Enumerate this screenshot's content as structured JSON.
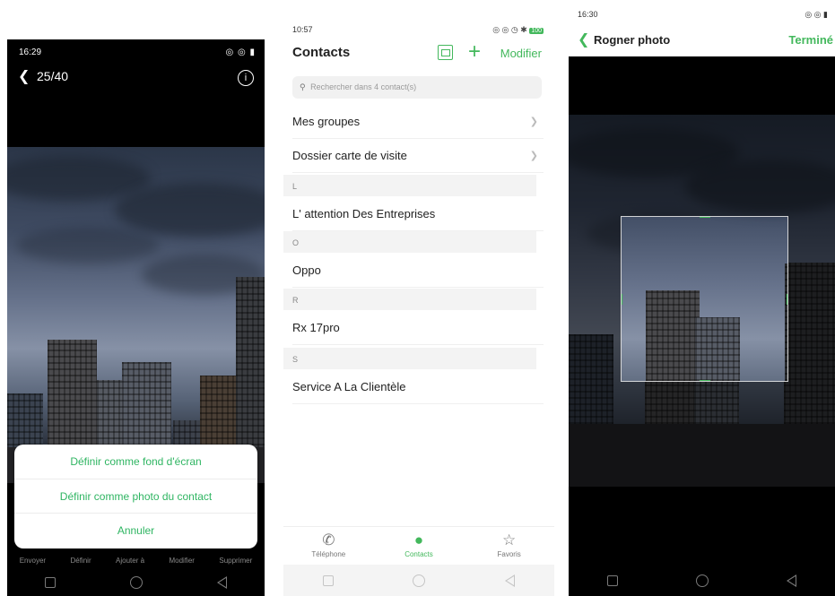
{
  "viewer": {
    "status_time": "16:29",
    "status_icons": "◎ ◎ ▮",
    "back_icon": "chevron-left-icon",
    "counter": "25/40",
    "info_glyph": "i",
    "actions": [
      "Envoyer",
      "Définir",
      "Ajouter à",
      "Modifier",
      "Supprimer"
    ],
    "sheet": {
      "items": [
        "Définir comme fond d'écran",
        "Définir comme photo du contact",
        "Annuler"
      ]
    }
  },
  "contacts": {
    "status_time": "10:57",
    "status_icons": "◎ ◎ ◷ ✱",
    "battery": "100",
    "title": "Contacts",
    "edit_label": "Modifier",
    "search_placeholder": "Rechercher dans 4 contact(s)",
    "rows_top": [
      "Mes groupes",
      "Dossier carte de visite"
    ],
    "sections": [
      {
        "letter": "L",
        "name": "L' attention Des Entreprises"
      },
      {
        "letter": "O",
        "name": "Oppo"
      },
      {
        "letter": "R",
        "name": "Rx 17pro"
      },
      {
        "letter": "S",
        "name": "Service A La Clientèle"
      }
    ],
    "tabs": [
      {
        "label": "Téléphone",
        "icon": "phone-icon",
        "active": false
      },
      {
        "label": "Contacts",
        "icon": "person-icon",
        "active": true
      },
      {
        "label": "Favoris",
        "icon": "star-icon",
        "active": false
      }
    ]
  },
  "crop": {
    "status_time": "16:30",
    "status_icons": "◎ ◎ ▮",
    "title": "Rogner photo",
    "done_label": "Terminé"
  },
  "colors": {
    "accent": "#43b85c"
  }
}
